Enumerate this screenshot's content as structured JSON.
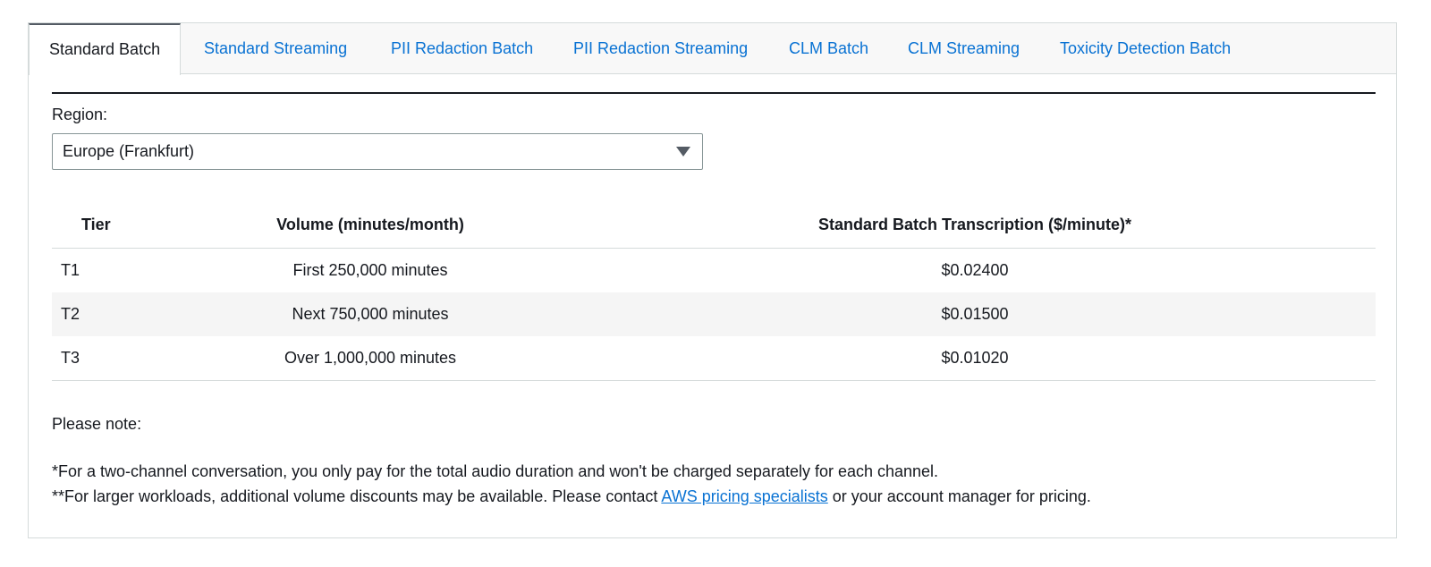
{
  "tabs": [
    {
      "label": "Standard Batch",
      "active": true
    },
    {
      "label": "Standard Streaming",
      "active": false
    },
    {
      "label": "PII Redaction Batch",
      "active": false
    },
    {
      "label": "PII Redaction Streaming",
      "active": false
    },
    {
      "label": "CLM Batch",
      "active": false
    },
    {
      "label": "CLM Streaming",
      "active": false
    },
    {
      "label": "Toxicity Detection Batch",
      "active": false
    }
  ],
  "region": {
    "label": "Region:",
    "selected": "Europe (Frankfurt)"
  },
  "table": {
    "headers": [
      "Tier",
      "Volume (minutes/month)",
      "Standard Batch Transcription ($/minute)*"
    ],
    "rows": [
      [
        "T1",
        "First 250,000 minutes",
        "$0.02400"
      ],
      [
        "T2",
        "Next 750,000 minutes",
        "$0.01500"
      ],
      [
        "T3",
        "Over 1,000,000 minutes",
        "$0.01020"
      ]
    ]
  },
  "notes": {
    "title": "Please note:",
    "line1": "*For a two-channel conversation, you only pay for the total audio duration and won't be charged separately for each channel.",
    "line2_before": "**For larger workloads, additional volume discounts may be available. Please contact ",
    "line2_link": "AWS pricing specialists",
    "line2_after": " or your account manager for pricing."
  },
  "colors": {
    "link": "#0972d3",
    "text": "#16191f",
    "border": "#d5dbdb",
    "row_alt": "#f5f5f5"
  },
  "icons": {
    "select_arrow": "caret-down-icon"
  }
}
